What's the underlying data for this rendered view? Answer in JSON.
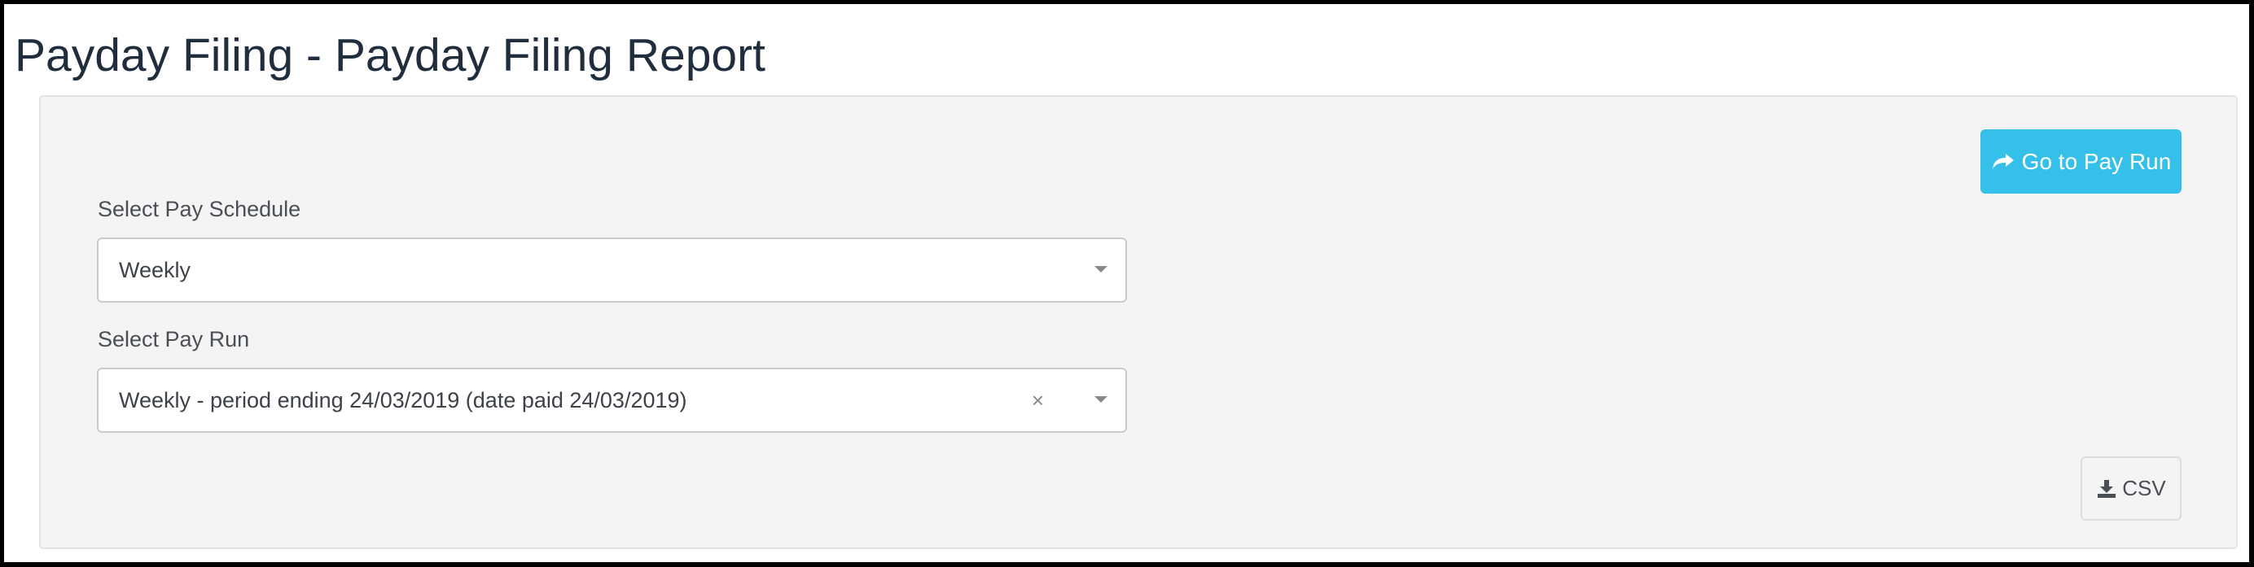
{
  "page": {
    "title": "Payday Filing - Payday Filing Report"
  },
  "toolbar": {
    "go_to_pay_run_label": "Go to Pay Run",
    "go_to_pay_run_icon": "share-arrow-icon",
    "csv_label": "CSV",
    "csv_icon": "download-icon"
  },
  "form": {
    "pay_schedule": {
      "label": "Select Pay Schedule",
      "value": "Weekly"
    },
    "pay_run": {
      "label": "Select Pay Run",
      "value": "Weekly - period ending 24/03/2019 (date paid 24/03/2019)",
      "clear_glyph": "×"
    }
  },
  "colors": {
    "accent": "#35c0ea",
    "title_text": "#1f2d3d",
    "panel_bg": "#f4f4f4"
  }
}
